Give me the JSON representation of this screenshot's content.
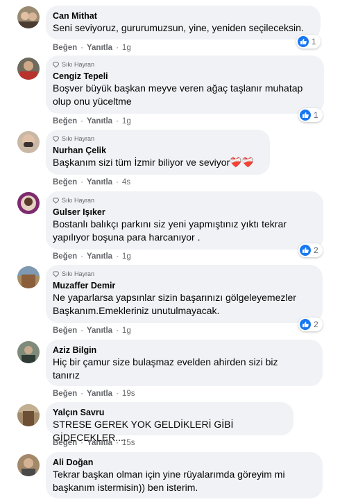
{
  "colors": {
    "like_blue": "#1877f2",
    "bubble": "#f0f2f5",
    "meta": "#65676b"
  },
  "labels": {
    "like": "Beğen",
    "reply": "Yanıtla",
    "badge": "Sıkı Hayran"
  },
  "comments": [
    {
      "author": "Can Mithat",
      "badge": false,
      "text": [
        "Seni seviyoruz, gururumuzsun, yine, yeniden seçileceksin."
      ],
      "time": "1g",
      "reactions": "1",
      "avatar_color": "#8a7d6a"
    },
    {
      "author": "Cengiz Tepeli",
      "badge": true,
      "text": [
        "Boşver büyük başkan meyve veren ağaç taşlanır muhatap",
        "olup onu yüceltme"
      ],
      "time": "1g",
      "reactions": "1",
      "avatar_color": "#6b5b4a"
    },
    {
      "author": "Nurhan Çelik",
      "badge": true,
      "text": [
        "Başkanım sizi tüm İzmir biliyor ve seviyor❤️‍🩹❤️‍🩹"
      ],
      "time": "4s",
      "reactions": "",
      "avatar_color": "#b59a86"
    },
    {
      "author": "Gulser Işıker",
      "badge": true,
      "text": [
        "Bostanlı balıkçı parkını siz yeni yapmıştınız yıktı tekrar",
        "yapılıyor boşuna para harcanıyor ."
      ],
      "time": "1g",
      "reactions": "2",
      "avatar_color": "#7a3b6d"
    },
    {
      "author": "Muzaffer Demir",
      "badge": true,
      "text": [
        "Ne yaparlarsa yapsınlar sizin başarınızı gölgeleyemezler",
        "Başkanım.Emekleriniz unutulmayacak."
      ],
      "time": "1g",
      "reactions": "2",
      "avatar_color": "#8c6e4f"
    },
    {
      "author": "Aziz Bilgin",
      "badge": false,
      "text": [
        "Hiç bir çamur size bulaşmaz evelden ahirden sizi biz",
        "tanırız"
      ],
      "time": "19s",
      "reactions": "",
      "avatar_color": "#5a6a5a"
    },
    {
      "author": "Yalçın Savru",
      "badge": false,
      "text": [
        "STRESE GEREK YOK GELDİKLERİ GİBİ GİDECEKLER...."
      ],
      "time": "15s",
      "reactions": "",
      "avatar_color": "#7b6348"
    },
    {
      "author": "Ali Doğan",
      "badge": false,
      "text": [
        "Tekrar başkan olman için yine rüyalarımda göreyim mi",
        "başkanım istermisin)) ben isterim."
      ],
      "time": "",
      "reactions": "",
      "avatar_color": "#8e7a5f"
    }
  ]
}
